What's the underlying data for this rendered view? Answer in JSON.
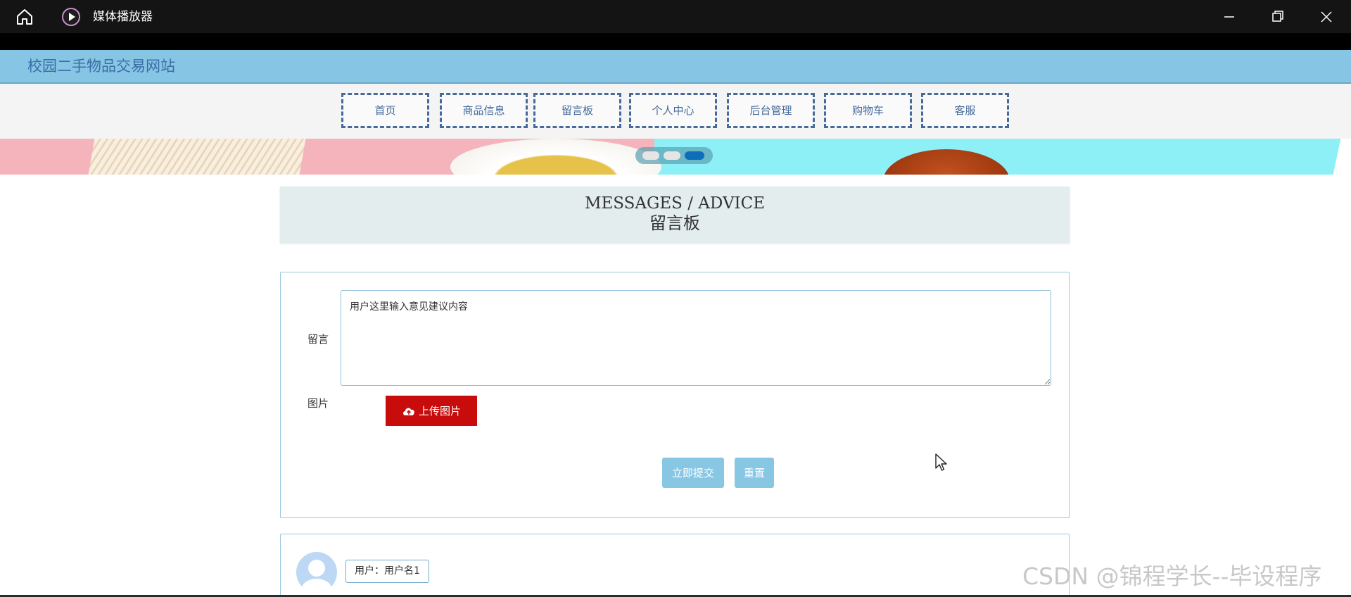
{
  "window": {
    "title": "媒体播放器"
  },
  "site": {
    "title": "校园二手物品交易网站"
  },
  "nav": {
    "items": [
      {
        "label": "首页"
      },
      {
        "label": "商品信息"
      },
      {
        "label": "留言板"
      },
      {
        "label": "个人中心"
      },
      {
        "label": "后台管理"
      },
      {
        "label": "购物车"
      },
      {
        "label": "客服"
      }
    ]
  },
  "carousel": {
    "slide_count": 3,
    "active_index": 2
  },
  "messages": {
    "title_en": "MESSAGES / ADVICE",
    "title_cn": "留言板"
  },
  "form": {
    "message_label": "留言",
    "message_value": "用户这里输入意见建议内容",
    "image_label": "图片",
    "upload_label": "上传图片",
    "submit_label": "立即提交",
    "reset_label": "重置"
  },
  "comments": [
    {
      "user": "用户：用户名1"
    }
  ],
  "watermark": "CSDN @锦程学长--毕设程序",
  "colors": {
    "header_bg": "#87c5e5",
    "nav_border": "#456a9b",
    "upload_button": "#c80b0b",
    "action_button": "#88c7e4"
  }
}
